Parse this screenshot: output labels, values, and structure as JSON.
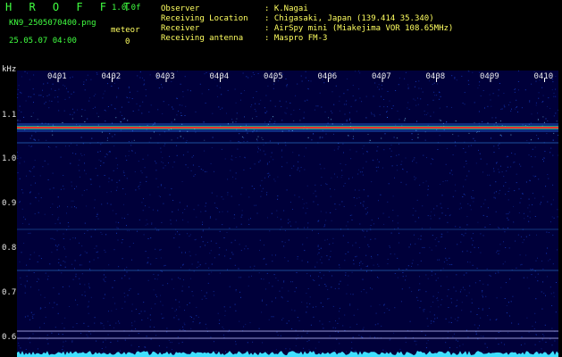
{
  "header": {
    "app_title": "H R O F F T",
    "version": "1.0.0f",
    "filename": "KN9_2505070400.png",
    "datetime": "25.05.07 04:00",
    "meteor_label": "meteor",
    "meteor_count": "0",
    "fields": [
      {
        "label": "Observer",
        "value": ": K.Nagai"
      },
      {
        "label": "Receiving Location",
        "value": ": Chigasaki, Japan (139.414 35.340)"
      },
      {
        "label": "Receiver",
        "value": ": AirSpy mini (Miakejima VOR 108.65MHz)"
      },
      {
        "label": "Receiving antenna",
        "value": ": Maspro FM-3"
      }
    ]
  },
  "y_axis": {
    "unit": "kHz",
    "ticks": [
      "1.1",
      "1.0",
      "0.9",
      "0.8",
      "0.7",
      "0.6"
    ]
  },
  "time_axis": {
    "ticks": [
      "0401",
      "0402",
      "0403",
      "0404",
      "0405",
      "0406",
      "0407",
      "0408",
      "0409",
      "0410"
    ]
  },
  "colors": {
    "background": "#00003a",
    "noise": "#1030c0",
    "carrier": "#ff3030",
    "halo": "#30ff80",
    "baseline": "#40e0ff"
  }
}
